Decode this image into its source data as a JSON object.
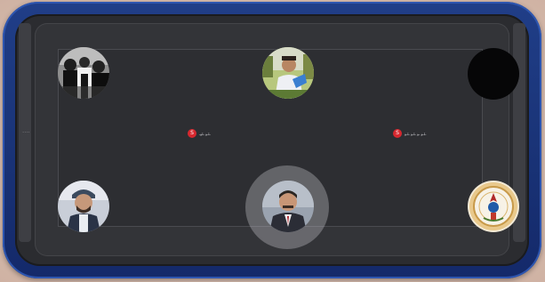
{
  "room": {
    "edge_label": "٠٠٠٠"
  },
  "seats": [
    {
      "id": "top-left",
      "avatar": "monochrome-group-photo-avatar"
    },
    {
      "id": "top-center",
      "avatar": "outdoor-man-avatar"
    },
    {
      "id": "top-right",
      "avatar": "empty-black-seat"
    },
    {
      "id": "bottom-left",
      "avatar": "man-in-cap-avatar"
    },
    {
      "id": "bottom-center",
      "avatar": "man-in-suit-avatar",
      "speaking": true
    },
    {
      "id": "bottom-right",
      "avatar": "emblem-logo-avatar"
    }
  ],
  "tags": [
    {
      "badge": "S",
      "text": "ـلـو ـلوـ"
    },
    {
      "badge": "S",
      "text": "ـلـو ـو ـلـو ـلـو"
    }
  ],
  "colors": {
    "frame_blue": "#1a3478",
    "screen_dark": "#2d2e32",
    "badge_red": "#d7282f"
  }
}
